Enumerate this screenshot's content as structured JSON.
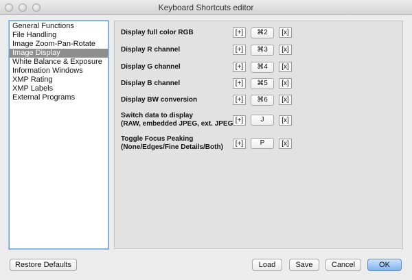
{
  "window": {
    "title": "Keyboard Shortcuts editor"
  },
  "sidebar": {
    "items": [
      {
        "label": "General Functions",
        "selected": false
      },
      {
        "label": "File Handling",
        "selected": false
      },
      {
        "label": "Image Zoom-Pan-Rotate",
        "selected": false
      },
      {
        "label": "Image Display",
        "selected": true
      },
      {
        "label": "White Balance & Exposure",
        "selected": false
      },
      {
        "label": "Information Windows",
        "selected": false
      },
      {
        "label": "XMP Rating",
        "selected": false
      },
      {
        "label": "XMP Labels",
        "selected": false
      },
      {
        "label": "External Programs",
        "selected": false
      }
    ]
  },
  "shortcuts": [
    {
      "label_lines": [
        "Display full color RGB"
      ],
      "add": "[+]",
      "key": "⌘2",
      "remove": "[x]"
    },
    {
      "label_lines": [
        "Display R channel"
      ],
      "add": "[+]",
      "key": "⌘3",
      "remove": "[x]"
    },
    {
      "label_lines": [
        "Display G channel"
      ],
      "add": "[+]",
      "key": "⌘4",
      "remove": "[x]"
    },
    {
      "label_lines": [
        "Display B channel"
      ],
      "add": "[+]",
      "key": "⌘5",
      "remove": "[x]"
    },
    {
      "label_lines": [
        "Display BW conversion"
      ],
      "add": "[+]",
      "key": "⌘6",
      "remove": "[x]"
    },
    {
      "label_lines": [
        "Switch data to display",
        "(RAW, embedded JPEG, ext. JPEG"
      ],
      "add": "[+]",
      "key": "J",
      "remove": "[x]"
    },
    {
      "label_lines": [
        "Toggle Focus Peaking",
        "(None/Edges/Fine Details/Both)"
      ],
      "add": "[+]",
      "key": "P",
      "remove": "[x]"
    }
  ],
  "buttons": {
    "restore_defaults": "Restore Defaults",
    "load": "Load",
    "save": "Save",
    "cancel": "Cancel",
    "ok": "OK"
  },
  "colors": {
    "selected_item_bg": "#8e8e8e",
    "focus_ring": "#6c9ddc",
    "default_button": "#7fb2ef"
  }
}
